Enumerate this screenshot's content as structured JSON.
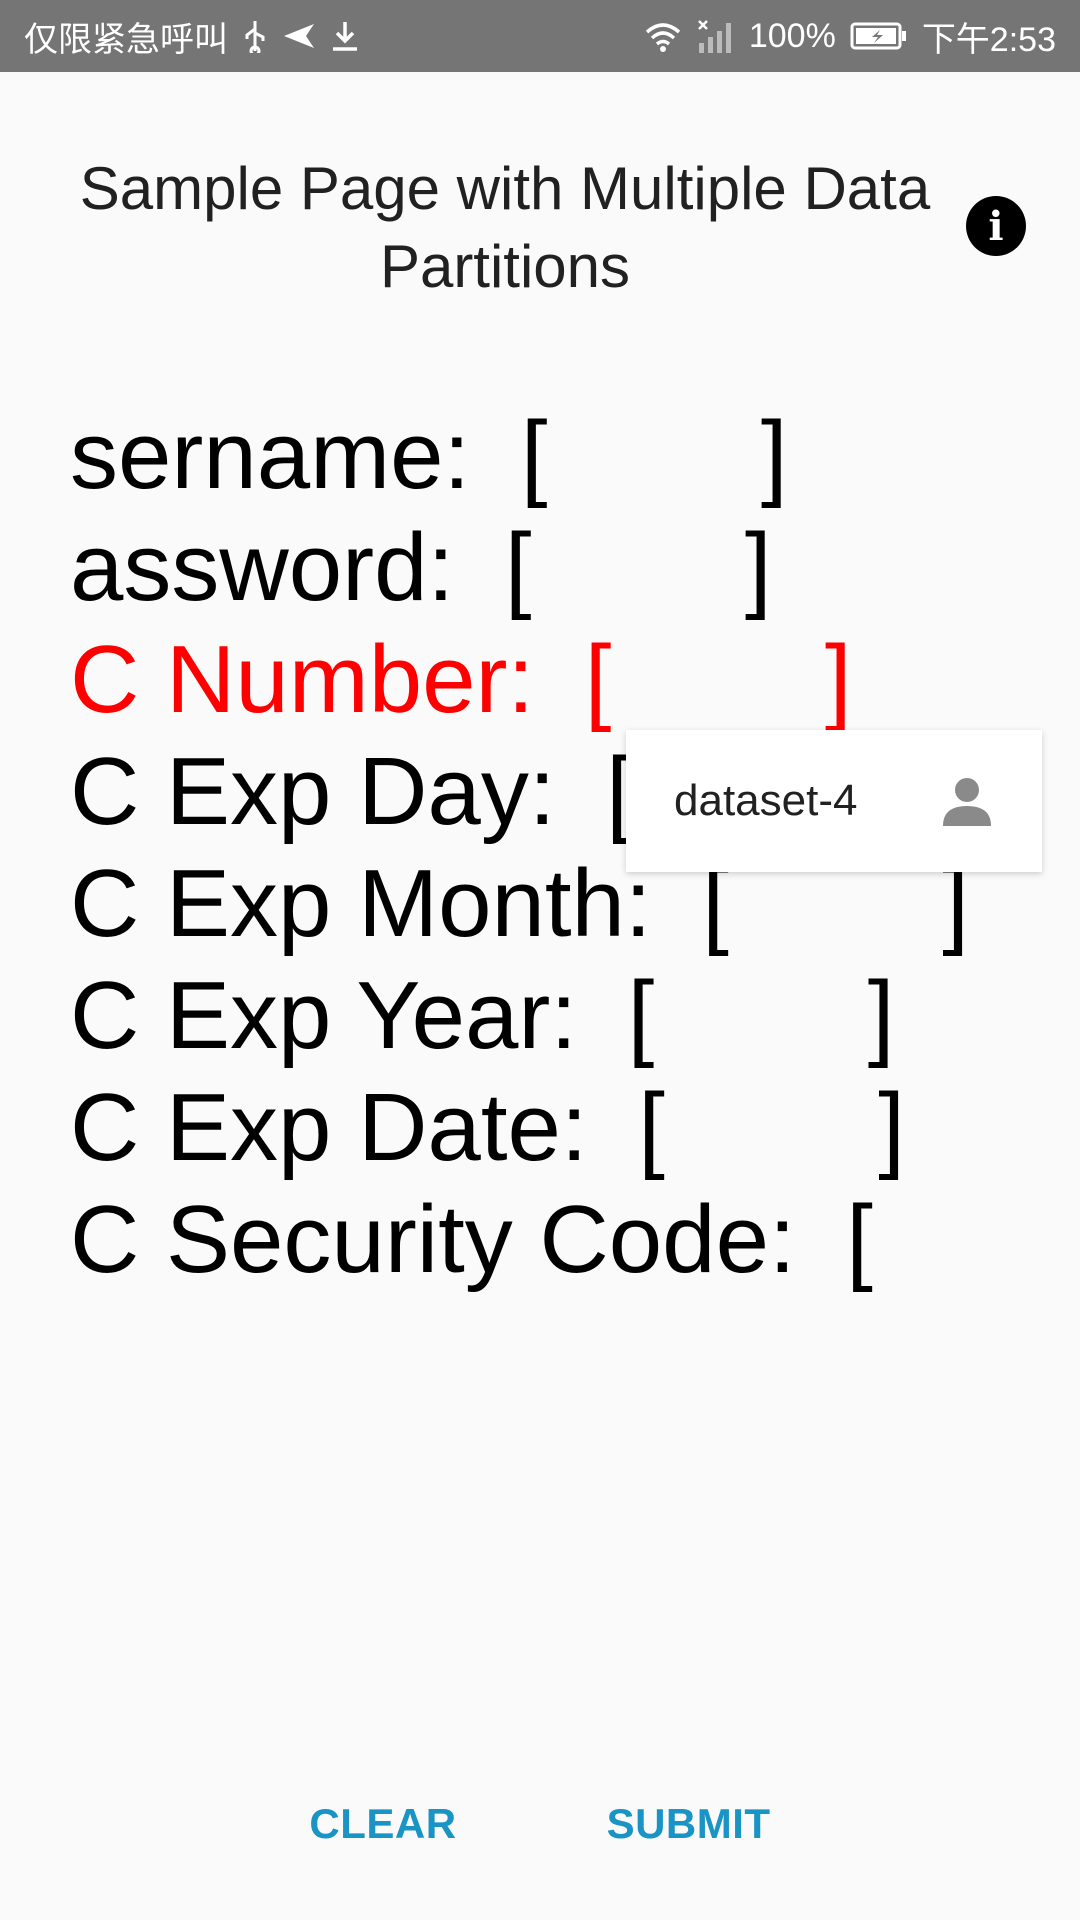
{
  "status_bar": {
    "carrier_text": "仅限紧急呼叫",
    "battery": "100%",
    "time": "下午2:53",
    "icons": [
      "usb-icon",
      "send-icon",
      "download-icon",
      "wifi-icon",
      "signal-icon",
      "battery-icon"
    ]
  },
  "header": {
    "title": "Sample Page with Multiple Data Partitions",
    "info_icon": "info-icon"
  },
  "fields": [
    {
      "label": "sername:",
      "input": "[ ]",
      "highlighted": false
    },
    {
      "label": "assword:",
      "input": "[ ]",
      "highlighted": false
    },
    {
      "label": "C Number:",
      "input": "[ ]",
      "highlighted": true
    },
    {
      "label": "C Exp Day:",
      "input": "[ ]",
      "highlighted": false
    },
    {
      "label": "C Exp Month:",
      "input": "[ ]",
      "highlighted": false
    },
    {
      "label": "C Exp Year:",
      "input": "[ ]",
      "highlighted": false
    },
    {
      "label": "C Exp Date:",
      "input": "[ ]",
      "highlighted": false
    },
    {
      "label": "C Security Code:",
      "input": "[",
      "highlighted": false
    }
  ],
  "autofill": {
    "dataset": "dataset-4",
    "icon": "person-icon"
  },
  "buttons": {
    "clear": "CLEAR",
    "submit": "SUBMIT"
  },
  "colors": {
    "status_bar": "#757575",
    "highlight": "#ff0000",
    "button_text": "#1a94c4",
    "background": "#fafafa"
  }
}
